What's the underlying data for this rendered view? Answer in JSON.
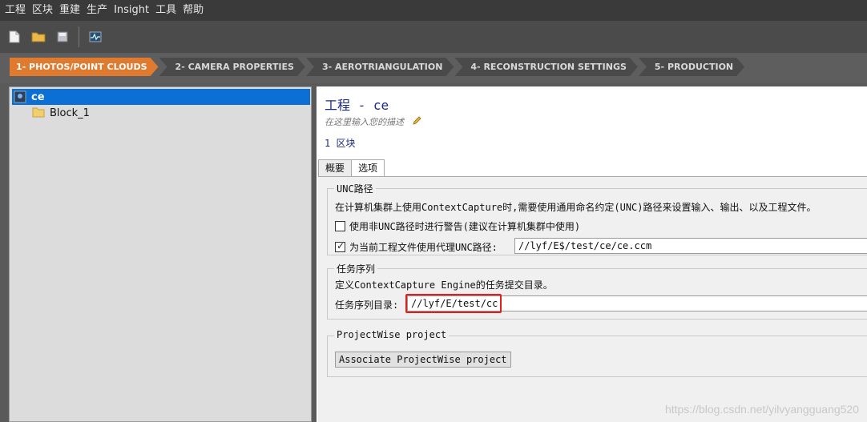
{
  "menu": [
    "工程",
    "区块",
    "重建",
    "生产",
    "Insight",
    "工具",
    "帮助"
  ],
  "toolbar": {
    "buttons": [
      "new-project-icon",
      "open-folder-icon",
      "save-icon",
      "monitor-icon"
    ]
  },
  "steps": [
    "1- PHOTOS/POINT CLOUDS",
    "2- CAMERA PROPERTIES",
    "3- AEROTRIANGULATION",
    "4- RECONSTRUCTION SETTINGS",
    "5- PRODUCTION"
  ],
  "colors": {
    "accent": "#e07a2f",
    "selection": "#0b6fd6",
    "highlight": "#e0201c",
    "title": "#1a2a8a"
  },
  "tree": {
    "root": "ce",
    "child": "Block_1"
  },
  "project": {
    "title": "工程 - ce",
    "description_placeholder": "在这里输入您的描述",
    "blocks": "1 区块"
  },
  "tabs": [
    "概要",
    "选项"
  ],
  "unc": {
    "label": "UNC路径",
    "desc": "在计算机集群上使用ContextCapture时,需要使用通用命名约定(UNC)路径来设置输入、输出、以及工程文件。",
    "warn_label": "使用非UNC路径时进行警告(建议在计算机集群中使用)",
    "proxy_label": "为当前工程文件使用代理UNC路径:",
    "proxy_value": "//lyf/E$/test/ce/ce.ccm"
  },
  "queue": {
    "label": "任务序列",
    "desc": "定义ContextCapture Engine的任务提交目录。",
    "dir_label": "任务序列目录:",
    "dir_value": "//lyf/E/test/cc"
  },
  "projectwise": {
    "label": "ProjectWise project",
    "button": "Associate ProjectWise project"
  },
  "watermark": "https://blog.csdn.net/yilvyangguang520"
}
